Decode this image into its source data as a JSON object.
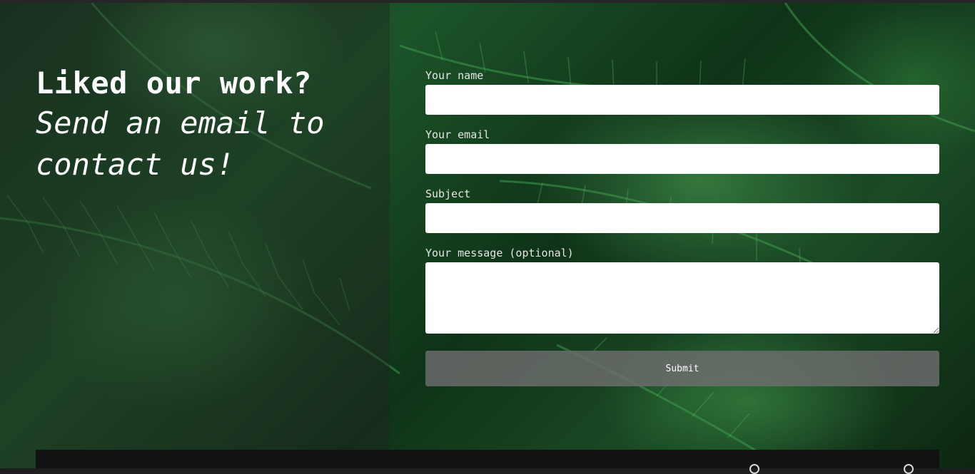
{
  "hero": {
    "heading_bold": "Liked our work?",
    "heading_italic_line1": "Send an email to",
    "heading_italic_line2": "contact us!"
  },
  "form": {
    "name_label": "Your name",
    "email_label": "Your email",
    "subject_label": "Subject",
    "message_label": "Your message (optional)",
    "name_value": "",
    "email_value": "",
    "subject_value": "",
    "message_value": "",
    "submit_label": "Submit"
  },
  "footer": {
    "icons": [
      "social-icon",
      "social-icon"
    ]
  },
  "colors": {
    "foliage": "#1c5428",
    "submit_bg": "#6e6e6e",
    "footer_bg": "#121212"
  }
}
